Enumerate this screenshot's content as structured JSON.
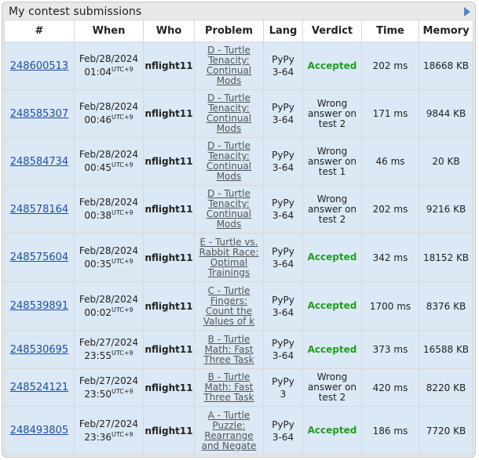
{
  "title": "My contest submissions",
  "headers": [
    "#",
    "When",
    "Who",
    "Problem",
    "Lang",
    "Verdict",
    "Time",
    "Memory"
  ],
  "rows": [
    {
      "id": "248600513",
      "date": "Feb/28/2024",
      "time": "01:04",
      "tz": "UTC+9",
      "who": "nflight11",
      "problem": [
        "D - Turtle",
        "Tenacity:",
        "Continual",
        "Mods"
      ],
      "lang": [
        "PyPy",
        "3-64"
      ],
      "verdict": [
        "Accepted"
      ],
      "accepted": true,
      "exec_time": "202 ms",
      "memory": "18668 KB"
    },
    {
      "id": "248585307",
      "date": "Feb/28/2024",
      "time": "00:46",
      "tz": "UTC+9",
      "who": "nflight11",
      "problem": [
        "D - Turtle",
        "Tenacity:",
        "Continual",
        "Mods"
      ],
      "lang": [
        "PyPy",
        "3-64"
      ],
      "verdict": [
        "Wrong",
        "answer on",
        "test 2"
      ],
      "accepted": false,
      "exec_time": "171 ms",
      "memory": "9844 KB"
    },
    {
      "id": "248584734",
      "date": "Feb/28/2024",
      "time": "00:45",
      "tz": "UTC+9",
      "who": "nflight11",
      "problem": [
        "D - Turtle",
        "Tenacity:",
        "Continual",
        "Mods"
      ],
      "lang": [
        "PyPy",
        "3-64"
      ],
      "verdict": [
        "Wrong",
        "answer on",
        "test 1"
      ],
      "accepted": false,
      "exec_time": "46 ms",
      "memory": "20 KB"
    },
    {
      "id": "248578164",
      "date": "Feb/28/2024",
      "time": "00:38",
      "tz": "UTC+9",
      "who": "nflight11",
      "problem": [
        "D - Turtle",
        "Tenacity:",
        "Continual",
        "Mods"
      ],
      "lang": [
        "PyPy",
        "3-64"
      ],
      "verdict": [
        "Wrong",
        "answer on",
        "test 2"
      ],
      "accepted": false,
      "exec_time": "202 ms",
      "memory": "9216 KB"
    },
    {
      "id": "248575604",
      "date": "Feb/28/2024",
      "time": "00:35",
      "tz": "UTC+9",
      "who": "nflight11",
      "problem": [
        "E - Turtle vs.",
        "Rabbit Race:",
        "Optimal",
        "Trainings"
      ],
      "lang": [
        "PyPy",
        "3-64"
      ],
      "verdict": [
        "Accepted"
      ],
      "accepted": true,
      "exec_time": "342 ms",
      "memory": "18152 KB"
    },
    {
      "id": "248539891",
      "date": "Feb/28/2024",
      "time": "00:02",
      "tz": "UTC+9",
      "who": "nflight11",
      "problem": [
        "C - Turtle",
        "Fingers:",
        "Count the",
        "Values of k"
      ],
      "lang": [
        "PyPy",
        "3-64"
      ],
      "verdict": [
        "Accepted"
      ],
      "accepted": true,
      "exec_time": "1700 ms",
      "memory": "8376 KB"
    },
    {
      "id": "248530695",
      "date": "Feb/27/2024",
      "time": "23:55",
      "tz": "UTC+9",
      "who": "nflight11",
      "problem": [
        "B - Turtle",
        "Math: Fast",
        "Three Task"
      ],
      "lang": [
        "PyPy",
        "3-64"
      ],
      "verdict": [
        "Accepted"
      ],
      "accepted": true,
      "exec_time": "373 ms",
      "memory": "16588 KB"
    },
    {
      "id": "248524121",
      "date": "Feb/27/2024",
      "time": "23:50",
      "tz": "UTC+9",
      "who": "nflight11",
      "problem": [
        "B - Turtle",
        "Math: Fast",
        "Three Task"
      ],
      "lang": [
        "PyPy",
        "3"
      ],
      "verdict": [
        "Wrong",
        "answer on",
        "test 2"
      ],
      "accepted": false,
      "exec_time": "420 ms",
      "memory": "8220 KB"
    },
    {
      "id": "248493805",
      "date": "Feb/27/2024",
      "time": "23:36",
      "tz": "UTC+9",
      "who": "nflight11",
      "problem": [
        "A - Turtle",
        "Puzzle:",
        "Rearrange",
        "and Negate"
      ],
      "lang": [
        "PyPy",
        "3-64"
      ],
      "verdict": [
        "Accepted"
      ],
      "accepted": true,
      "exec_time": "186 ms",
      "memory": "7720 KB"
    }
  ]
}
